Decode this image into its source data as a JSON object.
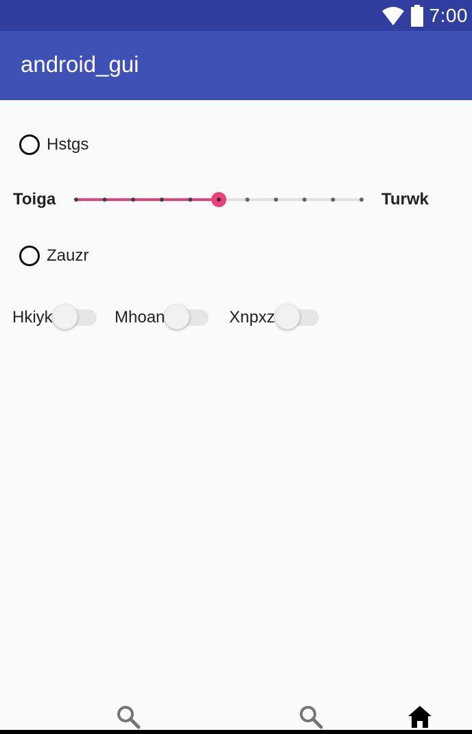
{
  "status_bar": {
    "time": "7:00",
    "icons": [
      "wifi-icon",
      "battery-icon"
    ]
  },
  "app_bar": {
    "title": "android_gui"
  },
  "radios": [
    {
      "label": "Hstgs",
      "checked": false
    },
    {
      "label": "Zauzr",
      "checked": false
    }
  ],
  "slider": {
    "label_left": "Toiga",
    "label_right": "Turwk",
    "steps": 10,
    "value": 5,
    "active_color": "#ec407a",
    "inactive_color": "#e0e0e0"
  },
  "switches": [
    {
      "label": "Hkiyk",
      "on": false
    },
    {
      "label": "Mhoan",
      "on": false
    },
    {
      "label": "Xnpxz",
      "on": false
    }
  ],
  "bottom_nav": {
    "items": [
      {
        "icon": "search-icon",
        "selected": false
      },
      {
        "icon": "search-icon",
        "selected": false
      },
      {
        "icon": "home-icon",
        "selected": true
      }
    ]
  },
  "colors": {
    "status_bar": "#303f9f",
    "app_bar": "#3f51b5",
    "background": "#fafafa"
  }
}
